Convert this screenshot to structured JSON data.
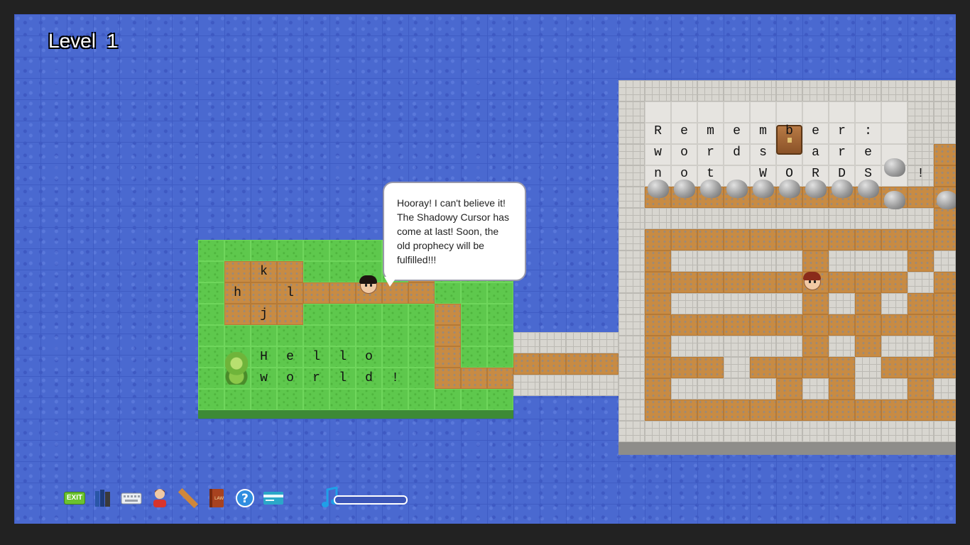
{
  "level": {
    "label": "Level",
    "number": "1"
  },
  "speech_bubble": {
    "text": "Hooray! I can't believe it! The Shadowy Cursor has come at last! Soon, the old prophecy will be fulfilled!!!"
  },
  "island_letters": [
    {
      "ch": "k",
      "c": 2,
      "r": 1
    },
    {
      "ch": "h",
      "c": 1,
      "r": 2
    },
    {
      "ch": "l",
      "c": 3,
      "r": 2
    },
    {
      "ch": "j",
      "c": 2,
      "r": 3
    },
    {
      "ch": "H",
      "c": 2,
      "r": 5
    },
    {
      "ch": "e",
      "c": 3,
      "r": 5
    },
    {
      "ch": "l",
      "c": 4,
      "r": 5
    },
    {
      "ch": "l",
      "c": 5,
      "r": 5
    },
    {
      "ch": "o",
      "c": 6,
      "r": 5
    },
    {
      "ch": "w",
      "c": 2,
      "r": 6
    },
    {
      "ch": "o",
      "c": 3,
      "r": 6
    },
    {
      "ch": "r",
      "c": 4,
      "r": 6
    },
    {
      "ch": "l",
      "c": 5,
      "r": 6
    },
    {
      "ch": "d",
      "c": 6,
      "r": 6
    },
    {
      "ch": "!",
      "c": 7,
      "r": 6
    }
  ],
  "castle_letters": [
    {
      "ch": "R",
      "c": 1,
      "r": 2
    },
    {
      "ch": "e",
      "c": 2,
      "r": 2
    },
    {
      "ch": "m",
      "c": 3,
      "r": 2
    },
    {
      "ch": "e",
      "c": 4,
      "r": 2
    },
    {
      "ch": "m",
      "c": 5,
      "r": 2
    },
    {
      "ch": "b",
      "c": 6,
      "r": 2
    },
    {
      "ch": "e",
      "c": 7,
      "r": 2
    },
    {
      "ch": "r",
      "c": 8,
      "r": 2
    },
    {
      "ch": ":",
      "c": 9,
      "r": 2
    },
    {
      "ch": "w",
      "c": 1,
      "r": 3
    },
    {
      "ch": "o",
      "c": 2,
      "r": 3
    },
    {
      "ch": "r",
      "c": 3,
      "r": 3
    },
    {
      "ch": "d",
      "c": 4,
      "r": 3
    },
    {
      "ch": "s",
      "c": 5,
      "r": 3
    },
    {
      "ch": "a",
      "c": 7,
      "r": 3
    },
    {
      "ch": "r",
      "c": 8,
      "r": 3
    },
    {
      "ch": "e",
      "c": 9,
      "r": 3
    },
    {
      "ch": "n",
      "c": 1,
      "r": 4
    },
    {
      "ch": "o",
      "c": 2,
      "r": 4
    },
    {
      "ch": "t",
      "c": 3,
      "r": 4
    },
    {
      "ch": "W",
      "c": 5,
      "r": 4
    },
    {
      "ch": "O",
      "c": 6,
      "r": 4
    },
    {
      "ch": "R",
      "c": 7,
      "r": 4
    },
    {
      "ch": "D",
      "c": 8,
      "r": 4
    },
    {
      "ch": "S",
      "c": 9,
      "r": 4
    },
    {
      "ch": "!",
      "c": 11,
      "r": 4
    }
  ],
  "toolbar": {
    "exit_label": "EXIT",
    "icons": [
      "exit-icon",
      "books-icon",
      "keyboard-icon",
      "character-icon",
      "ruler-icon",
      "lore-book-icon",
      "help-icon",
      "credit-card-icon",
      "music-note-icon"
    ]
  },
  "music_volume_fraction": 0
}
